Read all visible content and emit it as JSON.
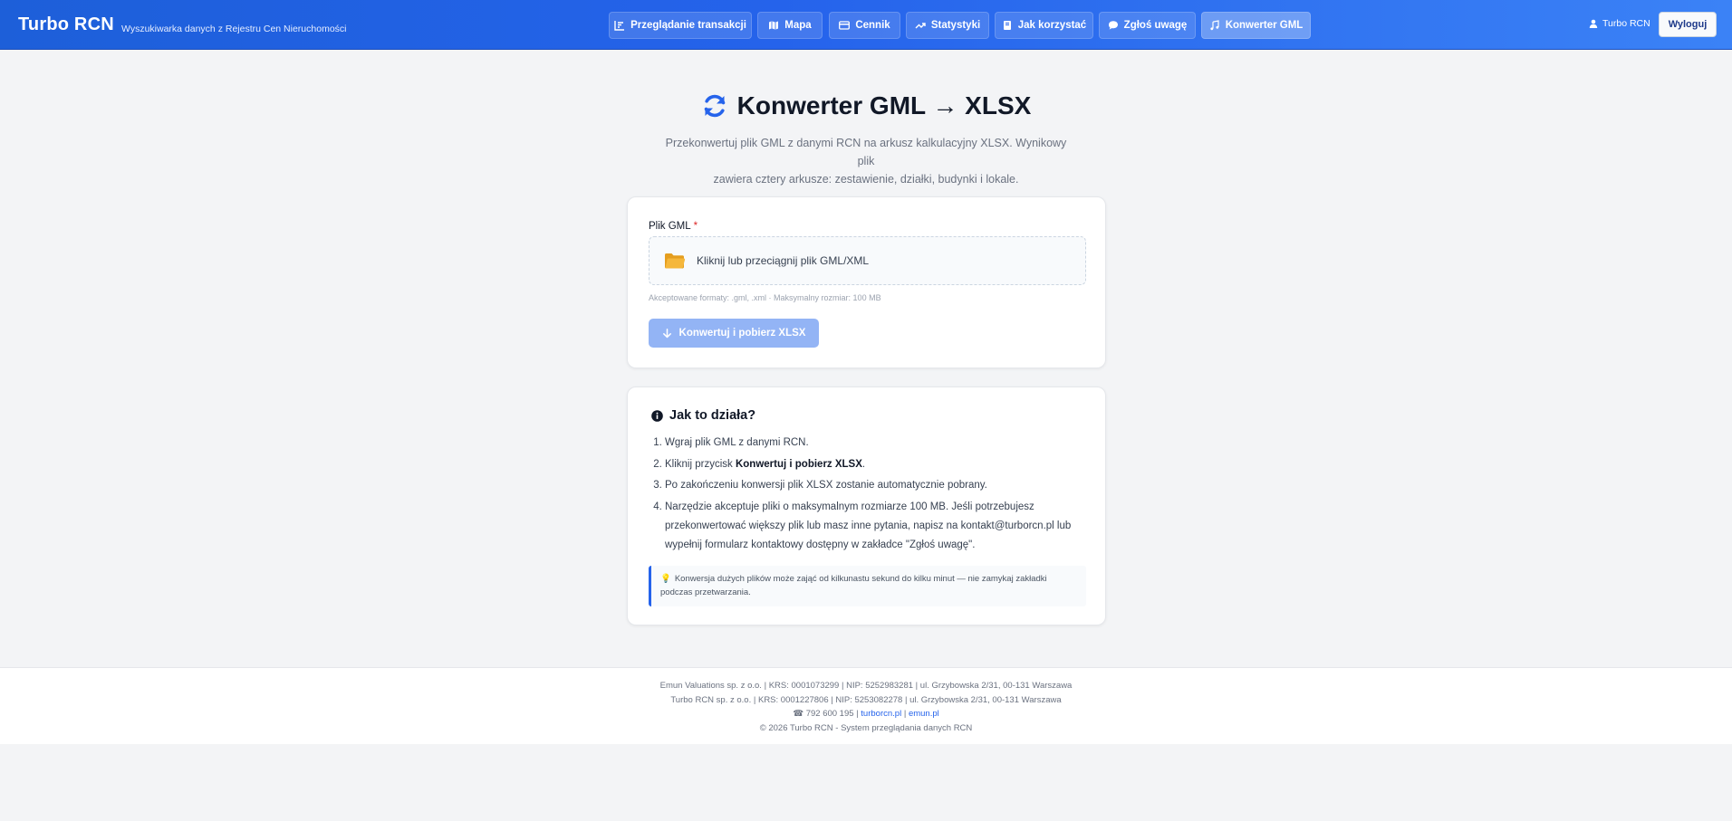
{
  "header": {
    "brand": "Turbo RCN",
    "tagline": "Wyszukiwarka danych z Rejestru Cen Nieruchomości",
    "nav": [
      {
        "label": "Przeglądanie transakcji",
        "icon": "list-chart-icon"
      },
      {
        "label": "Mapa",
        "icon": "map-icon"
      },
      {
        "label": "Cennik",
        "icon": "credit-card-icon"
      },
      {
        "label": "Statystyki",
        "icon": "trend-up-icon"
      },
      {
        "label": "Jak korzystać",
        "icon": "book-icon"
      },
      {
        "label": "Zgłoś uwagę",
        "icon": "comment-icon"
      },
      {
        "label": "Konwerter GML",
        "icon": "music-note-icon"
      }
    ],
    "active_nav": "Konwerter GML",
    "user": "Turbo RCN",
    "logout": "Wyloguj"
  },
  "main": {
    "title": "Konwerter GML → XLSX",
    "intro_line1": "Przekonwertuj plik GML z danymi RCN na arkusz kalkulacyjny XLSX. Wynikowy plik",
    "intro_line2": "zawiera cztery arkusze: zestawienie, działki, budynki i lokale."
  },
  "upload": {
    "field_label": "Plik GML",
    "required_mark": "*",
    "dropzone_text": "Kliknij lub przeciągnij plik GML/XML",
    "hint": "Akceptowane formaty: .gml, .xml · Maksymalny rozmiar: 100 MB",
    "button": "Konwertuj i pobierz XLSX"
  },
  "help": {
    "title": "Jak to działa?",
    "step1": "Wgraj plik GML z danymi RCN.",
    "step2_prefix": "Kliknij przycisk ",
    "step2_bold": "Konwertuj i pobierz XLSX",
    "step2_suffix": ".",
    "step3": "Po zakończeniu konwersji plik XLSX zostanie automatycznie pobrany.",
    "step4": "Narzędzie akceptuje pliki o maksymalnym rozmiarze 100 MB. Jeśli potrzebujesz przekonwertować większy plik lub masz inne pytania, napisz na kontakt@turborcn.pl lub wypełnij formularz kontaktowy dostępny w zakładce \"Zgłoś uwagę\".",
    "tip": "Konwersja dużych plików może zająć od kilkunastu sekund do kilku minut — nie zamykaj zakładki podczas przetwarzania."
  },
  "footer": {
    "line1": "Emun Valuations sp. z o.o. | KRS: 0001073299 | NIP: 5252983281 | ul. Grzybowska 2/31, 00-131 Warszawa",
    "line2": "Turbo RCN sp. z o.o. | KRS: 0001227806 | NIP: 5253082278 | ul. Grzybowska 2/31, 00-131 Warszawa",
    "phone": "☎ 792 600 195 |",
    "link1": "turborcn.pl",
    "separator": "|",
    "link2": "emun.pl",
    "copyright": "© 2026 Turbo RCN - System przeglądania danych RCN"
  },
  "colors": {
    "header_primary": "#2563eb",
    "accent": "#2563eb",
    "button_disabled": "#93b4f5",
    "required": "#dc2626",
    "folder": "#f5b73b"
  }
}
